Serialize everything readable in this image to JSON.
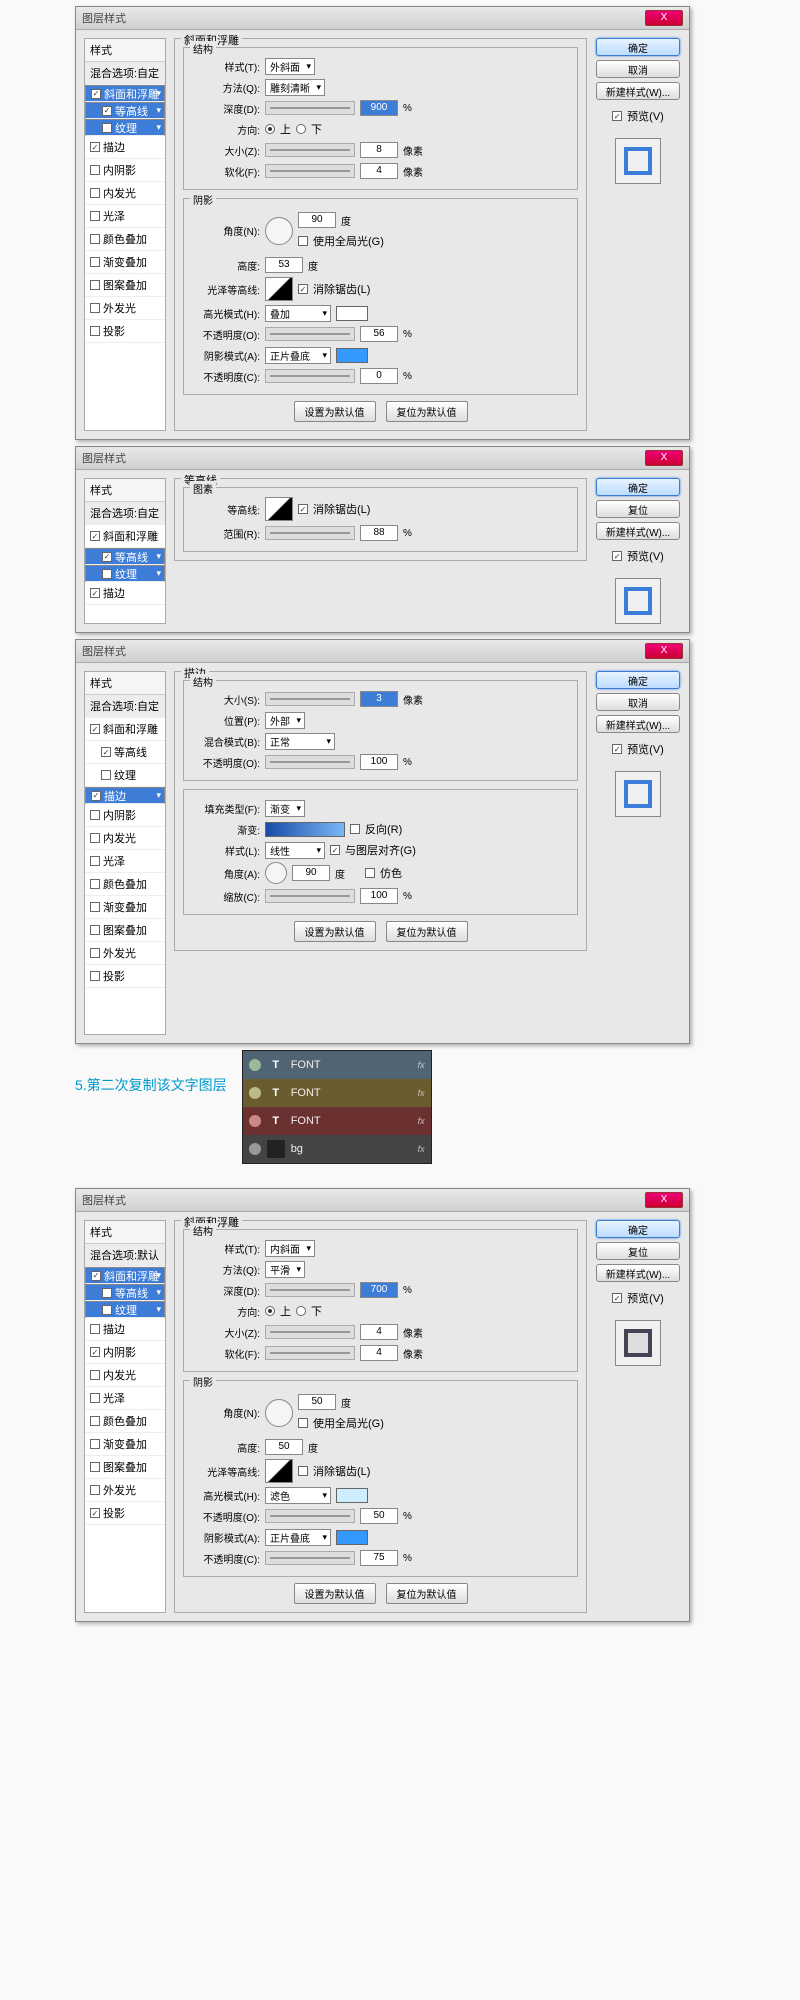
{
  "common": {
    "title": "图层样式",
    "closeX": "X",
    "styles_header": "样式",
    "blend_custom": "混合选项:自定",
    "blend_default": "混合选项:默认",
    "ok": "确定",
    "cancel": "取消",
    "reset": "复位",
    "new_style": "新建样式(W)...",
    "preview": "预览(V)",
    "set_default": "设置为默认值",
    "reset_default": "复位为默认值"
  },
  "s": {
    "bevel": "斜面和浮雕",
    "contour": "等高线",
    "texture": "纹理",
    "stroke": "描边",
    "innershadow": "内阴影",
    "innerglow": "内发光",
    "satin": "光泽",
    "coloroverlay": "颜色叠加",
    "gradientoverlay": "渐变叠加",
    "patternoverlay": "图案叠加",
    "outerglow": "外发光",
    "dropshadow": "投影"
  },
  "d1": {
    "panel_title": "斜面和浮雕",
    "grp_struct": "结构",
    "style_l": "样式(T):",
    "style_v": "外斜面",
    "technique_l": "方法(Q):",
    "technique_v": "雕刻清晰",
    "depth_l": "深度(D):",
    "depth_v": "900",
    "pct": "%",
    "dir_l": "方向:",
    "dir_up": "上",
    "dir_down": "下",
    "size_l": "大小(Z):",
    "size_v": "8",
    "px": "像素",
    "soften_l": "软化(F):",
    "soften_v": "4",
    "grp_shade": "阴影",
    "angle_l": "角度(N):",
    "angle_v": "90",
    "deg": "度",
    "global": "使用全局光(G)",
    "alt_l": "高度:",
    "alt_v": "53",
    "gloss_l": "光泽等高线:",
    "aa": "消除锯齿(L)",
    "hl_mode_l": "高光模式(H):",
    "hl_mode_v": "叠加",
    "hl_op_l": "不透明度(O):",
    "hl_op_v": "56",
    "sh_mode_l": "阴影模式(A):",
    "sh_mode_v": "正片叠底",
    "sh_op_l": "不透明度(C):",
    "sh_op_v": "0"
  },
  "d2": {
    "panel_title": "等高线",
    "grp": "图素",
    "contour_l": "等高线:",
    "aa": "消除锯齿(L)",
    "range_l": "范围(R):",
    "range_v": "88",
    "pct": "%"
  },
  "d3": {
    "panel_title": "描边",
    "grp_struct": "结构",
    "size_l": "大小(S):",
    "size_v": "3",
    "px": "像素",
    "pos_l": "位置(P):",
    "pos_v": "外部",
    "blend_l": "混合模式(B):",
    "blend_v": "正常",
    "op_l": "不透明度(O):",
    "op_v": "100",
    "pct": "%",
    "fill_l": "填充类型(F):",
    "fill_v": "渐变",
    "grad_l": "渐变:",
    "reverse": "反向(R)",
    "style_l": "样式(L):",
    "style_v": "线性",
    "align": "与图层对齐(G)",
    "angle_l": "角度(A):",
    "angle_v": "90",
    "deg": "度",
    "dither": "仿色",
    "scale_l": "缩放(C):",
    "scale_v": "100"
  },
  "d4": {
    "panel_title": "斜面和浮雕",
    "grp_struct": "结构",
    "style_l": "样式(T):",
    "style_v": "内斜面",
    "technique_l": "方法(Q):",
    "technique_v": "平滑",
    "depth_l": "深度(D):",
    "depth_v": "700",
    "pct": "%",
    "dir_l": "方向:",
    "dir_up": "上",
    "dir_down": "下",
    "size_l": "大小(Z):",
    "size_v": "4",
    "px": "像素",
    "soften_l": "软化(F):",
    "soften_v": "4",
    "grp_shade": "阴影",
    "angle_l": "角度(N):",
    "angle_v": "50",
    "deg": "度",
    "global": "使用全局光(G)",
    "alt_l": "高度:",
    "alt_v": "50",
    "gloss_l": "光泽等高线:",
    "aa": "消除锯齿(L)",
    "hl_mode_l": "高光模式(H):",
    "hl_mode_v": "滤色",
    "hl_op_l": "不透明度(O):",
    "hl_op_v": "50",
    "sh_mode_l": "阴影模式(A):",
    "sh_mode_v": "正片叠底",
    "sh_op_l": "不透明度(C):",
    "sh_op_v": "75"
  },
  "step": "5.第二次复制该文字图层",
  "layers": {
    "font": "FONT",
    "bg": "bg",
    "fx": "fx",
    "T": "T"
  }
}
